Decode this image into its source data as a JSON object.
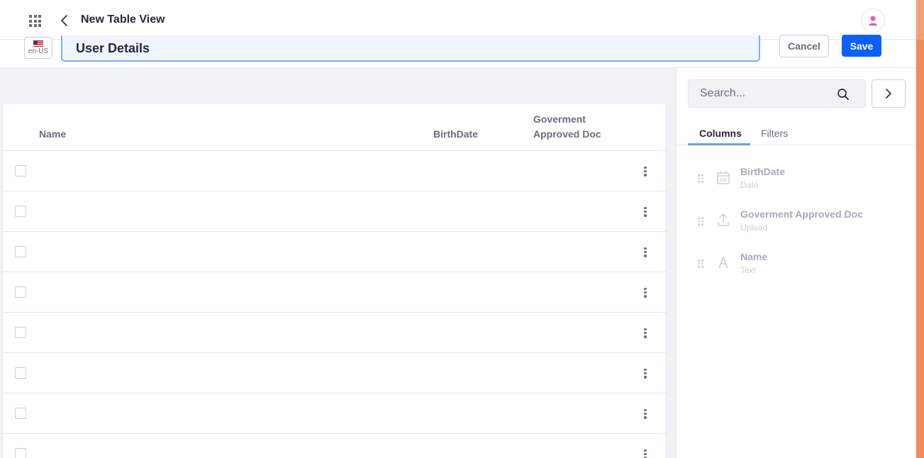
{
  "header": {
    "title": "New Table View",
    "apps_icon": "apps-grid-icon",
    "back_icon": "chevron-left-icon",
    "avatar_icon": "user-icon"
  },
  "toolbar": {
    "locale_label": "en-US",
    "locale_flag": "us-flag-icon",
    "title_value": "User Details",
    "cancel_label": "Cancel",
    "save_label": "Save"
  },
  "table": {
    "columns": [
      "Name",
      "BirthDate",
      "Goverment Approved Doc"
    ],
    "row_count": 8
  },
  "sidebar": {
    "search_placeholder": "Search...",
    "search_icon": "search-icon",
    "expand_icon": "chevron-right-icon",
    "tabs": [
      {
        "label": "Columns",
        "active": true
      },
      {
        "label": "Filters",
        "active": false
      }
    ],
    "fields": [
      {
        "name": "BirthDate",
        "type": "Date",
        "icon": "calendar-icon"
      },
      {
        "name": "Goverment Approved Doc",
        "type": "Upload",
        "icon": "upload-icon"
      },
      {
        "name": "Name",
        "type": "Text",
        "icon": "text-icon"
      }
    ]
  },
  "colors": {
    "primary": "#0b5fff",
    "canvas_bg": "#f1f2f5",
    "edge_accent": "#ef8c5b",
    "text_secondary": "#6b6c7e",
    "avatar_accent": "#e85aad"
  }
}
